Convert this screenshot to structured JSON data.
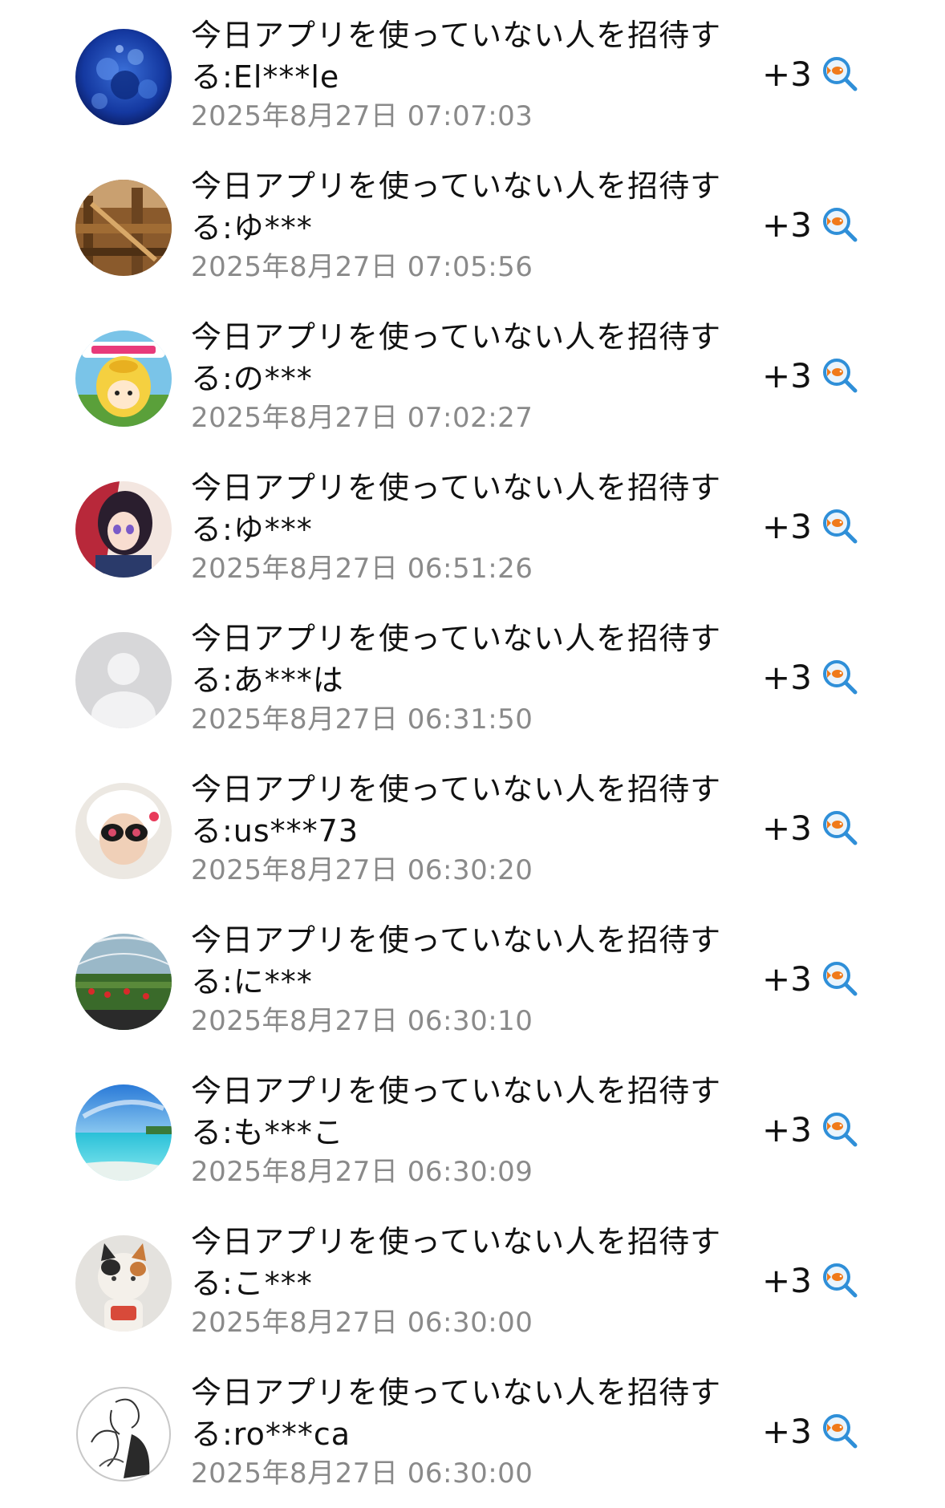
{
  "activity_list": {
    "items": [
      {
        "line1": "今日アプリを使っていない人を招待す",
        "line2": "る:El***le",
        "timestamp": "2025年8月27日 07:07:03",
        "points": "+3",
        "avatar": "ocean-coral"
      },
      {
        "line1": "今日アプリを使っていない人を招待す",
        "line2": "る:ゆ***",
        "timestamp": "2025年8月27日 07:05:56",
        "points": "+3",
        "avatar": "wooden-structure"
      },
      {
        "line1": "今日アプリを使っていない人を招待す",
        "line2": "る:の***",
        "timestamp": "2025年8月27日 07:02:27",
        "points": "+3",
        "avatar": "shirataki-character"
      },
      {
        "line1": "今日アプリを使っていない人を招待す",
        "line2": "る:ゆ***",
        "timestamp": "2025年8月27日 06:51:26",
        "points": "+3",
        "avatar": "anime-girl"
      },
      {
        "line1": "今日アプリを使っていない人を招待す",
        "line2": "る:あ***は",
        "timestamp": "2025年8月27日 06:31:50",
        "points": "+3",
        "avatar": "default-user"
      },
      {
        "line1": "今日アプリを使っていない人を招待す",
        "line2": "る:us***73",
        "timestamp": "2025年8月27日 06:30:20",
        "points": "+3",
        "avatar": "child-sunglasses"
      },
      {
        "line1": "今日アプリを使っていない人を招待す",
        "line2": "る:に***",
        "timestamp": "2025年8月27日 06:30:10",
        "points": "+3",
        "avatar": "strawberry-greenhouse"
      },
      {
        "line1": "今日アプリを使っていない人を招待す",
        "line2": "る:も***こ",
        "timestamp": "2025年8月27日 06:30:09",
        "points": "+3",
        "avatar": "tropical-beach"
      },
      {
        "line1": "今日アプリを使っていない人を招待す",
        "line2": "る:こ***",
        "timestamp": "2025年8月27日 06:30:00",
        "points": "+3",
        "avatar": "calico-cat"
      },
      {
        "line1": "今日アプリを使っていない人を招待す",
        "line2": "る:ro***ca",
        "timestamp": "2025年8月27日 06:30:00",
        "points": "+3",
        "avatar": "sketch-drawing"
      }
    ]
  },
  "colors": {
    "title_text": "#111111",
    "timestamp_text": "#8a8a8a",
    "icon_blue": "#2f8fd8",
    "fish_orange": "#f07a1a"
  },
  "icons": {
    "row_action": "search-fish-icon"
  }
}
